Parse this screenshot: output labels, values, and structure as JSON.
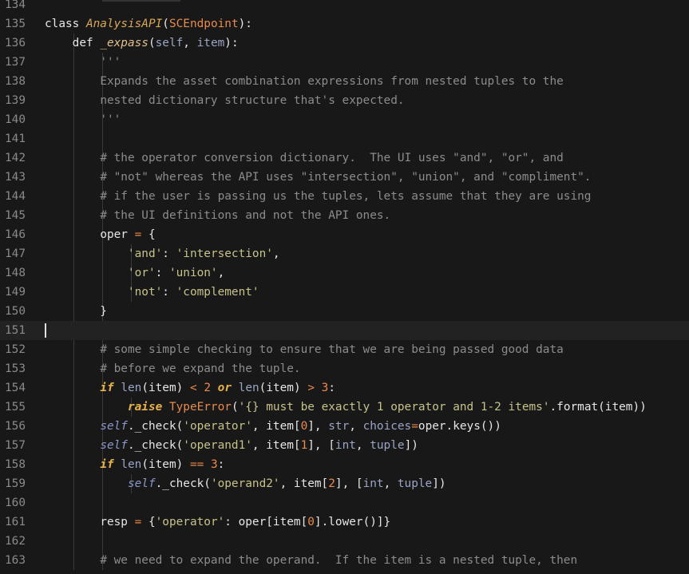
{
  "editor": {
    "current_line": "151",
    "lines": [
      {
        "n": "134",
        "code": [],
        "guides": 0
      },
      {
        "n": "135",
        "code": [
          [
            "kw",
            "class "
          ],
          [
            "cls",
            "AnalysisAPI"
          ],
          [
            "txt",
            "("
          ],
          [
            "base",
            "SCEndpoint"
          ],
          [
            "txt",
            "):"
          ]
        ],
        "guides": 0
      },
      {
        "n": "136",
        "code": [
          [
            "txt",
            "    "
          ],
          [
            "kw",
            "def "
          ],
          [
            "fn",
            "_expass"
          ],
          [
            "txt",
            "("
          ],
          [
            "prm",
            "self"
          ],
          [
            "txt",
            ", "
          ],
          [
            "prm",
            "item"
          ],
          [
            "txt",
            "):"
          ]
        ],
        "guides": 1
      },
      {
        "n": "137",
        "code": [
          [
            "txt",
            "        "
          ],
          [
            "doc",
            "'''"
          ]
        ],
        "guides": 2
      },
      {
        "n": "138",
        "code": [
          [
            "txt",
            "        "
          ],
          [
            "doc",
            "Expands the asset combination expressions from nested tuples to the"
          ]
        ],
        "guides": 2
      },
      {
        "n": "139",
        "code": [
          [
            "txt",
            "        "
          ],
          [
            "doc",
            "nested dictionary structure that's expected."
          ]
        ],
        "guides": 2
      },
      {
        "n": "140",
        "code": [
          [
            "txt",
            "        "
          ],
          [
            "doc",
            "'''"
          ]
        ],
        "guides": 2
      },
      {
        "n": "141",
        "code": [],
        "guides": 2
      },
      {
        "n": "142",
        "code": [
          [
            "txt",
            "        "
          ],
          [
            "cmt",
            "# the operator conversion dictionary.  The UI uses \"and\", \"or\", and"
          ]
        ],
        "guides": 2
      },
      {
        "n": "143",
        "code": [
          [
            "txt",
            "        "
          ],
          [
            "cmt",
            "# \"not\" whereas the API uses \"intersection\", \"union\", and \"compliment\"."
          ]
        ],
        "guides": 2
      },
      {
        "n": "144",
        "code": [
          [
            "txt",
            "        "
          ],
          [
            "cmt",
            "# if the user is passing us the tuples, lets assume that they are using"
          ]
        ],
        "guides": 2
      },
      {
        "n": "145",
        "code": [
          [
            "txt",
            "        "
          ],
          [
            "cmt",
            "# the UI definitions and not the API ones."
          ]
        ],
        "guides": 2
      },
      {
        "n": "146",
        "code": [
          [
            "txt",
            "        "
          ],
          [
            "txt",
            "oper "
          ],
          [
            "op",
            "="
          ],
          [
            "txt",
            " {"
          ]
        ],
        "guides": 2
      },
      {
        "n": "147",
        "code": [
          [
            "txt",
            "            "
          ],
          [
            "str",
            "'and'"
          ],
          [
            "txt",
            ": "
          ],
          [
            "str",
            "'intersection'"
          ],
          [
            "txt",
            ","
          ]
        ],
        "guides": 3
      },
      {
        "n": "148",
        "code": [
          [
            "txt",
            "            "
          ],
          [
            "str",
            "'or'"
          ],
          [
            "txt",
            ": "
          ],
          [
            "str",
            "'union'"
          ],
          [
            "txt",
            ","
          ]
        ],
        "guides": 3
      },
      {
        "n": "149",
        "code": [
          [
            "txt",
            "            "
          ],
          [
            "str",
            "'not'"
          ],
          [
            "txt",
            ": "
          ],
          [
            "str",
            "'complement'"
          ]
        ],
        "guides": 3
      },
      {
        "n": "150",
        "code": [
          [
            "txt",
            "        }"
          ]
        ],
        "guides": 2
      },
      {
        "n": "151",
        "code": [],
        "guides": 0,
        "current": true
      },
      {
        "n": "152",
        "code": [
          [
            "txt",
            "        "
          ],
          [
            "cmt",
            "# some simple checking to ensure that we are being passed good data"
          ]
        ],
        "guides": 2
      },
      {
        "n": "153",
        "code": [
          [
            "txt",
            "        "
          ],
          [
            "cmt",
            "# before we expand the tuple."
          ]
        ],
        "guides": 2
      },
      {
        "n": "154",
        "code": [
          [
            "txt",
            "        "
          ],
          [
            "ctl",
            "if "
          ],
          [
            "bi",
            "len"
          ],
          [
            "txt",
            "(item) "
          ],
          [
            "op",
            "<"
          ],
          [
            "txt",
            " "
          ],
          [
            "num",
            "2"
          ],
          [
            "txt",
            " "
          ],
          [
            "ctl",
            "or "
          ],
          [
            "bi",
            "len"
          ],
          [
            "txt",
            "(item) "
          ],
          [
            "op",
            ">"
          ],
          [
            "txt",
            " "
          ],
          [
            "num",
            "3"
          ],
          [
            "txt",
            ":"
          ]
        ],
        "guides": 2
      },
      {
        "n": "155",
        "code": [
          [
            "txt",
            "            "
          ],
          [
            "ctl",
            "raise "
          ],
          [
            "base",
            "TypeError"
          ],
          [
            "txt",
            "("
          ],
          [
            "str",
            "'{} must be exactly 1 operator and 1-2 items'"
          ],
          [
            "txt",
            ".format(item))"
          ]
        ],
        "guides": 3
      },
      {
        "n": "156",
        "code": [
          [
            "txt",
            "        "
          ],
          [
            "slf",
            "self"
          ],
          [
            "txt",
            "._check("
          ],
          [
            "str",
            "'operator'"
          ],
          [
            "txt",
            ", item["
          ],
          [
            "num",
            "0"
          ],
          [
            "txt",
            "], "
          ],
          [
            "bi",
            "str"
          ],
          [
            "txt",
            ", "
          ],
          [
            "prm",
            "choices"
          ],
          [
            "op",
            "="
          ],
          [
            "txt",
            "oper.keys())"
          ]
        ],
        "guides": 2
      },
      {
        "n": "157",
        "code": [
          [
            "txt",
            "        "
          ],
          [
            "slf",
            "self"
          ],
          [
            "txt",
            "._check("
          ],
          [
            "str",
            "'operand1'"
          ],
          [
            "txt",
            ", item["
          ],
          [
            "num",
            "1"
          ],
          [
            "txt",
            "], ["
          ],
          [
            "bi",
            "int"
          ],
          [
            "txt",
            ", "
          ],
          [
            "bi",
            "tuple"
          ],
          [
            "txt",
            "])"
          ]
        ],
        "guides": 2
      },
      {
        "n": "158",
        "code": [
          [
            "txt",
            "        "
          ],
          [
            "ctl",
            "if "
          ],
          [
            "bi",
            "len"
          ],
          [
            "txt",
            "(item) "
          ],
          [
            "op",
            "=="
          ],
          [
            "txt",
            " "
          ],
          [
            "num",
            "3"
          ],
          [
            "txt",
            ":"
          ]
        ],
        "guides": 2
      },
      {
        "n": "159",
        "code": [
          [
            "txt",
            "            "
          ],
          [
            "slf",
            "self"
          ],
          [
            "txt",
            "._check("
          ],
          [
            "str",
            "'operand2'"
          ],
          [
            "txt",
            ", item["
          ],
          [
            "num",
            "2"
          ],
          [
            "txt",
            "], ["
          ],
          [
            "bi",
            "int"
          ],
          [
            "txt",
            ", "
          ],
          [
            "bi",
            "tuple"
          ],
          [
            "txt",
            "])"
          ]
        ],
        "guides": 3
      },
      {
        "n": "160",
        "code": [],
        "guides": 2
      },
      {
        "n": "161",
        "code": [
          [
            "txt",
            "        "
          ],
          [
            "txt",
            "resp "
          ],
          [
            "op",
            "="
          ],
          [
            "txt",
            " {"
          ],
          [
            "str",
            "'operator'"
          ],
          [
            "txt",
            ": oper[item["
          ],
          [
            "num",
            "0"
          ],
          [
            "txt",
            "].lower()]}"
          ]
        ],
        "guides": 2
      },
      {
        "n": "162",
        "code": [],
        "guides": 2
      },
      {
        "n": "163",
        "code": [
          [
            "txt",
            "        "
          ],
          [
            "cmt",
            "# we need to expand the operand.  If the item is a nested tuple, then"
          ]
        ],
        "guides": 2
      }
    ]
  }
}
